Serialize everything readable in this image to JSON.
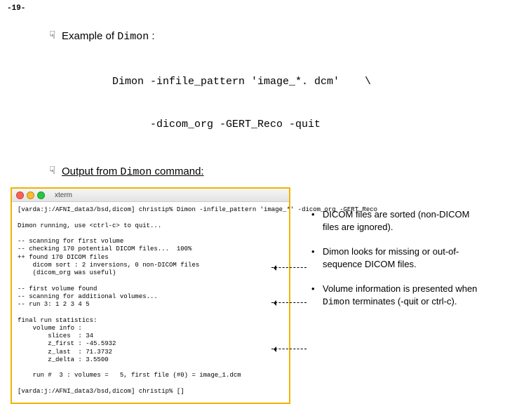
{
  "page_number": "-19-",
  "bullet1_pre": "Example of ",
  "bullet1_code": "Dimon",
  "bullet1_post": " :",
  "cmd_line1": "Dimon -infile_pattern 'image_*. dcm'    \\",
  "cmd_line2": "-dicom_org -GERT_Reco -quit",
  "bullet2_pre": "Output from ",
  "bullet2_code": "Dimon",
  "bullet2_post": " command:",
  "term_title": "xterm",
  "term_text": "[varda:j:/AFNI_data3/bsd,dicom] christip% Dimon -infile_pattern 'image_*' -dicom_org -GERT_Reco\n\nDimon running, use <ctrl-c> to quit...\n\n-- scanning for first volume\n-- checking 170 potential DICOM files...  100%\n++ found 170 DICOM files\n    dicom sort : 2 inversions, 0 non-DICOM files\n    (dicom_org was useful)\n\n-- first volume found\n-- scanning for additional volumes...\n-- run 3: 1 2 3 4 5\n\nfinal run statistics:\n    volume info :\n        slices  : 34\n        z_first : -45.5932\n        z_last  : 71.3732\n        z_delta : 3.5500\n\n    run #  3 : volumes =   5, first file (#0) = image_1.dcm\n\n[varda:j:/AFNI_data3/bsd,dicom] christip% []",
  "notes": [
    {
      "text_pre": "DICOM files are sorted (non-DICOM files are ignored).",
      "text_code": "",
      "text_post": ""
    },
    {
      "text_pre": "Dimon looks for missing or out-of-sequence DICOM files.",
      "text_code": "",
      "text_post": ""
    },
    {
      "text_pre": "Volume information is presented when ",
      "text_code": "Dimon",
      "text_post": " terminates (-quit or ctrl-c)."
    }
  ]
}
